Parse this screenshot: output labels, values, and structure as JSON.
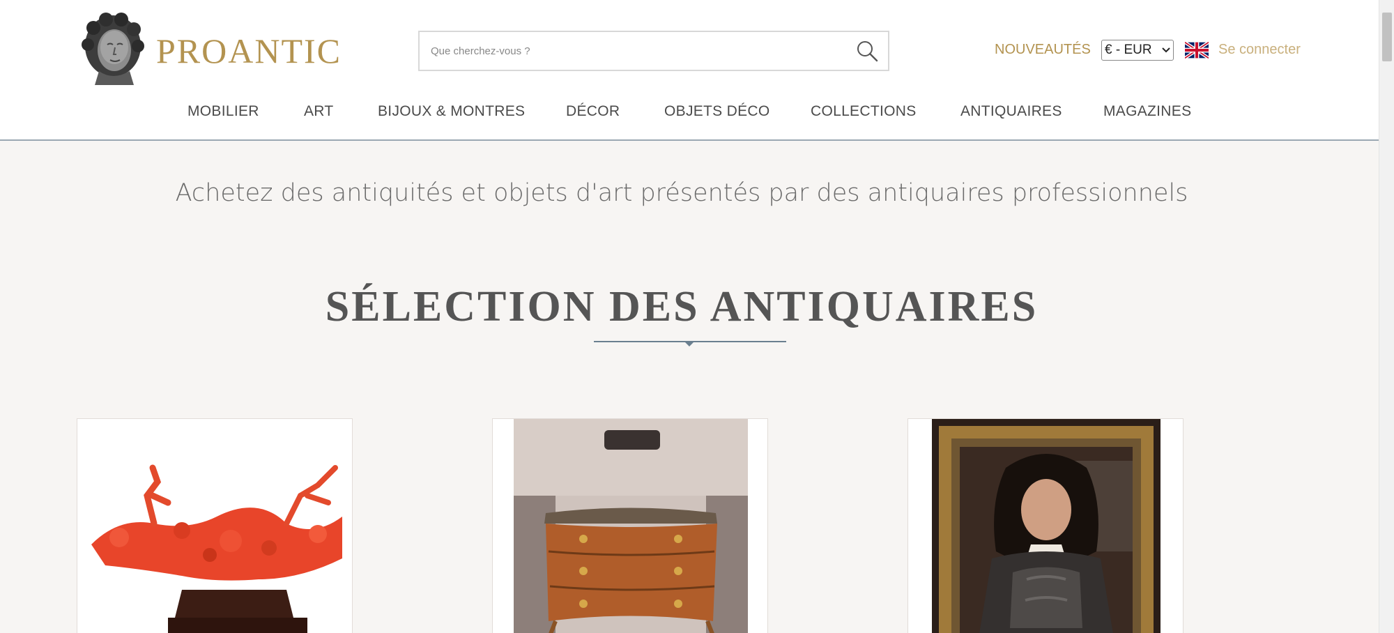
{
  "header": {
    "logo_text": "PROANTIC",
    "search_placeholder": "Que cherchez-vous ?",
    "nouveautes": "NOUVEAUTÉS",
    "currency_selected": "€ - EUR",
    "login": "Se connecter"
  },
  "nav": {
    "items": [
      {
        "label": "MOBILIER"
      },
      {
        "label": "ART"
      },
      {
        "label": "BIJOUX & MONTRES"
      },
      {
        "label": "DÉCOR"
      },
      {
        "label": "OBJETS DÉCO"
      },
      {
        "label": "COLLECTIONS"
      },
      {
        "label": "ANTIQUAIRES"
      },
      {
        "label": "MAGAZINES"
      }
    ]
  },
  "main": {
    "tagline": "Achetez des antiquités et objets d'art présentés par des antiquaires professionnels",
    "section_title": "SÉLECTION DES ANTIQUAIRES"
  },
  "icons": {
    "search": "search-icon",
    "flag": "uk-flag-icon",
    "logo": "logo-bust-icon",
    "dropdown": "chevron-down-icon"
  },
  "colors": {
    "brand_gold": "#b39350",
    "login_gold": "#c9b07d",
    "page_background": "#f7f5f3",
    "nav_rule": "#9aa8b2"
  }
}
